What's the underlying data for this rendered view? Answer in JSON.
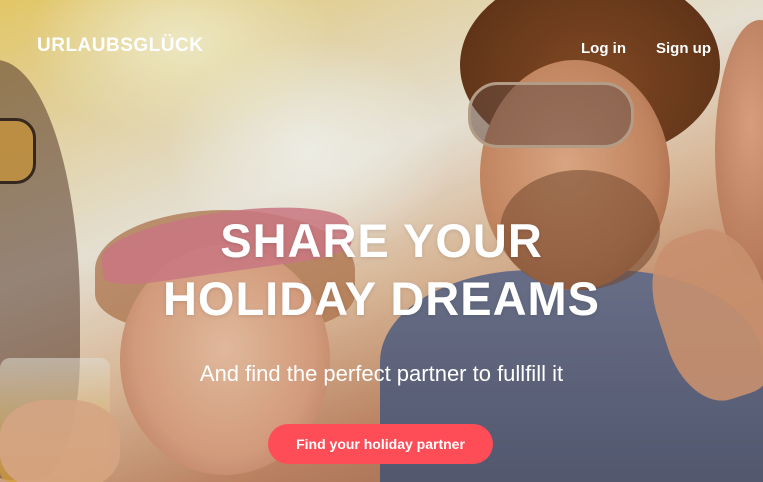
{
  "header": {
    "logo": "URLAUBSGLÜCK",
    "nav": {
      "login": "Log in",
      "signup": "Sign up"
    }
  },
  "hero": {
    "headline_line1": "SHARE YOUR",
    "headline_line2": "HOLIDAY DREAMS",
    "subline": "And find the perfect partner to fullfill it",
    "cta_label": "Find your holiday partner"
  },
  "colors": {
    "cta_background": "#ff4d57",
    "text": "#ffffff"
  }
}
